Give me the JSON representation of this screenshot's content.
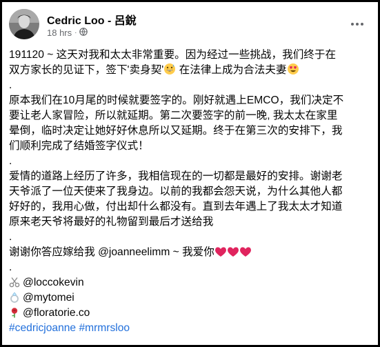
{
  "post": {
    "author": "Cedric Loo - 呂銳",
    "time": "18 hrs",
    "dot": "·",
    "lines": {
      "l1a": "191120 ~ 这天对我和太太非常重要。因为经过一些挑战，我们终于在",
      "l2a": "双方家长的见证下，签下'卖身契'",
      "l2b": " 在法律上成为合法夫妻",
      "dot1": ".",
      "l4": "原本我们在10月尾的时候就要签字的。刚好就遇上EMCO，我们决定不",
      "l5": "要让老人家冒险，所以就延期。第二次要签字的前一晚, 我太太在家里",
      "l6": "晕倒，临时决定让她好好休息所以又延期。终于在第三次的安排下，我",
      "l7": "们顺利完成了结婚签字仪式！",
      "dot2": ".",
      "l9": "爱情的道路上经历了许多，我相信现在的一切都是最好的安排。谢谢老",
      "l10": "天爷派了一位天使来了我身边。以前的我都会怨天说，为什么其他人都",
      "l11": "好好的，我用心做，付出却什么都没有。直到去年遇上了我太太才知道",
      "l12": "原来老天爷将最好的礼物留到最后才送给我",
      "dot3": ".",
      "l14": "谢谢你答应嫁给我 @joanneelimm ~ 我爱你",
      "dot4": "."
    },
    "credits": [
      {
        "icon": "scissors-icon",
        "handle": "@loccokevin"
      },
      {
        "icon": "ring-icon",
        "handle": "@mytomei"
      },
      {
        "icon": "rose-icon",
        "handle": "@floratorie.co"
      }
    ],
    "hashtags": [
      "#cedricjoanne",
      "#mrmrsloo"
    ]
  },
  "colors": {
    "hashtag": "#216fdb",
    "meta": "#65676b",
    "heart": "#e0245e"
  }
}
